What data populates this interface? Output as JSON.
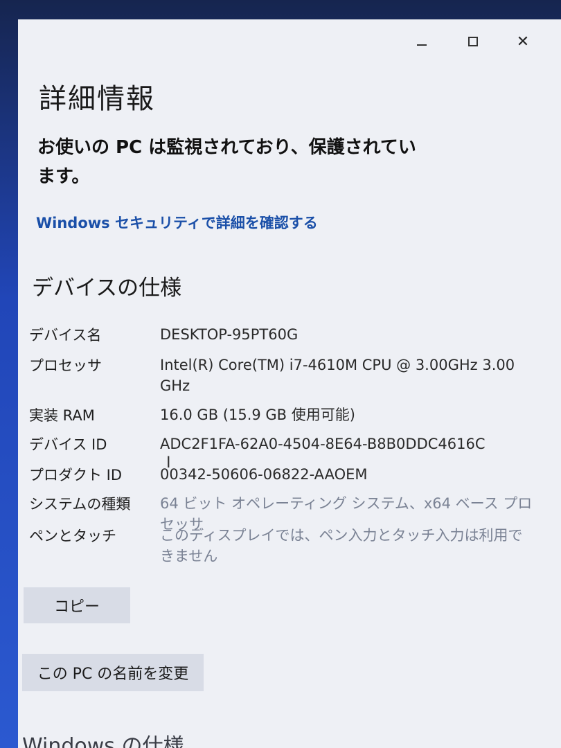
{
  "window": {
    "minimize_glyph": "—",
    "maximize_glyph": "□",
    "close_glyph": "✕"
  },
  "header": {
    "title": "詳細情報",
    "protection_message": "お使いの PC は監視されており、保護されています。",
    "security_link": "Windows セキュリティで詳細を確認する"
  },
  "device_specs": {
    "heading": "デバイスの仕様",
    "rows": [
      {
        "label": "デバイス名",
        "value": "DESKTOP-95PT60G"
      },
      {
        "label": "プロセッサ",
        "value": "Intel(R) Core(TM) i7-4610M CPU @ 3.00GHz   3.00 GHz"
      },
      {
        "label": "実装 RAM",
        "value": "16.0 GB (15.9 GB 使用可能)"
      },
      {
        "label": "デバイス ID",
        "value": "ADC2F1FA-62A0-4504-8E64-B8B0DDC4616C"
      },
      {
        "label": "プロダクト ID",
        "value": "00342-50606-06822-AAOEM"
      },
      {
        "label": "システムの種類",
        "value": "64 ビット オペレーティング システム、x64 ベース プロセッサ"
      },
      {
        "label": "ペンとタッチ",
        "value": "このディスプレイでは、ペン入力とタッチ入力は利用できません"
      }
    ]
  },
  "actions": {
    "copy_label": "コピー",
    "rename_label": "この PC の名前を変更"
  },
  "windows_specs": {
    "heading": "Windows の仕様"
  },
  "colors": {
    "link": "#1a4fa8",
    "window_bg": "#eef0f5",
    "button_bg": "#d8dce6"
  }
}
